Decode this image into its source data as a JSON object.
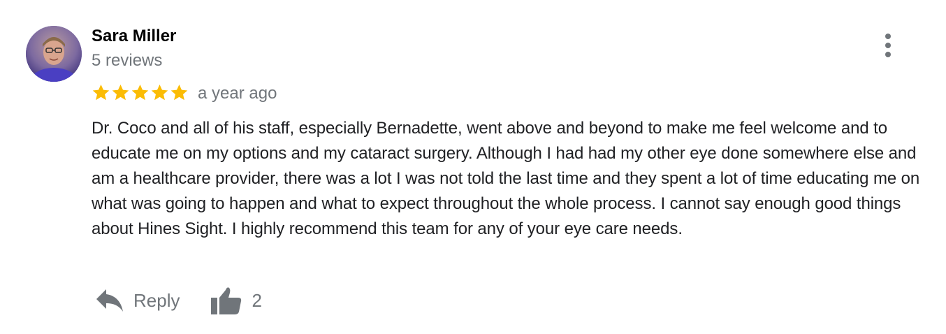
{
  "review": {
    "author": "Sara Miller",
    "review_count": "5 reviews",
    "rating": 5,
    "rating_max": 5,
    "date": "a year ago",
    "text": "Dr. Coco and all of his staff, especially Bernadette, went above and beyond to make me feel welcome and to educate me on my options and my cataract surgery. Although I had had my other eye done somewhere else and am a healthcare provider, there was a lot I was not told the last time and they spent a lot of time educating me on what was going to happen and what to expect throughout the whole process. I cannot say enough good things about Hines Sight. I highly recommend this team for any of your eye care needs.",
    "reply_label": "Reply",
    "like_count": "2"
  },
  "icons": {
    "star": "star-icon",
    "more": "more-vert-icon",
    "reply": "reply-icon",
    "like": "thumb-up-icon",
    "avatar": "avatar"
  },
  "colors": {
    "star": "#fbbc04",
    "secondary_text": "#70757a",
    "primary_text": "#202124"
  }
}
